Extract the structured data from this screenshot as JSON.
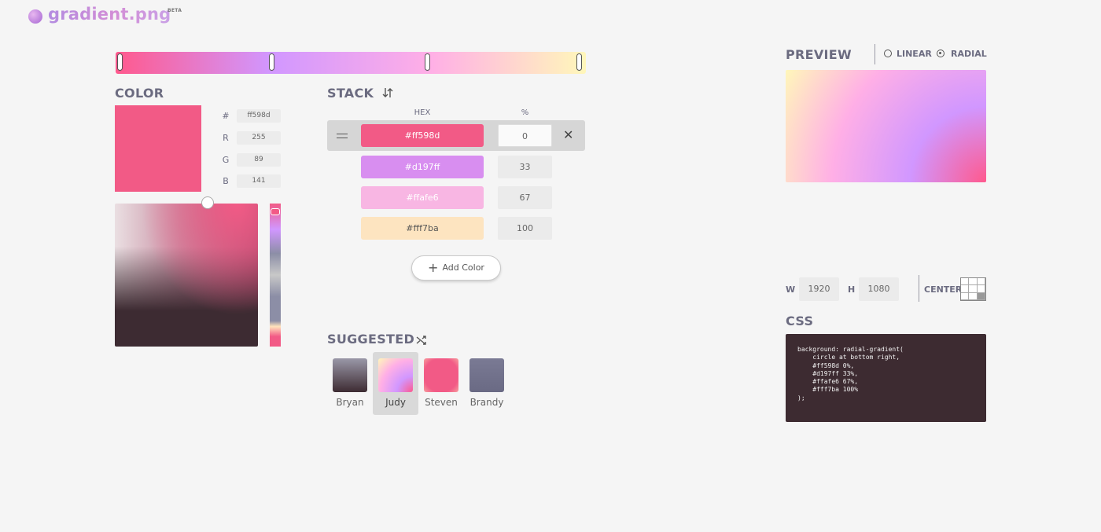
{
  "app": {
    "name": "gradient.png",
    "badge": "BETA"
  },
  "gradient": {
    "stops": [
      {
        "hex": "#ff598d",
        "percent": "0",
        "color": "#f25a86"
      },
      {
        "hex": "#d197ff",
        "percent": "33",
        "color": "#d88ef0"
      },
      {
        "hex": "#ffafe6",
        "percent": "67",
        "color": "#f8b6e3"
      },
      {
        "hex": "#fff7ba",
        "percent": "100",
        "color": "#fde4c0"
      }
    ]
  },
  "color": {
    "title": "COLOR",
    "hex_label": "#",
    "hex_value": "ff598d",
    "r_label": "R",
    "r_value": "255",
    "g_label": "G",
    "g_value": "89",
    "b_label": "B",
    "b_value": "141"
  },
  "stack": {
    "title": "STACK",
    "col_hex": "HEX",
    "col_pct": "%",
    "rows": [
      {
        "hex": "#ff598d",
        "pct": "0"
      },
      {
        "hex": "#d197ff",
        "pct": "33"
      },
      {
        "hex": "#ffafe6",
        "pct": "67"
      },
      {
        "hex": "#fff7ba",
        "pct": "100"
      }
    ],
    "add_label": "Add Color"
  },
  "suggested": {
    "title": "SUGGESTED",
    "items": [
      {
        "name": "Bryan"
      },
      {
        "name": "Judy"
      },
      {
        "name": "Steven"
      },
      {
        "name": "Brandy"
      }
    ]
  },
  "preview": {
    "title": "PREVIEW",
    "linear_label": "LINEAR",
    "radial_label": "RADIAL",
    "selected": "RADIAL"
  },
  "size": {
    "w_label": "W",
    "w_value": "1920",
    "h_label": "H",
    "h_value": "1080",
    "anchor_label": "CENTER"
  },
  "css": {
    "title": "CSS",
    "code": "background: radial-gradient(\n    circle at bottom right,\n    #ff598d 0%,\n    #d197ff 33%,\n    #ffafe6 67%,\n    #fff7ba 100%\n);"
  }
}
